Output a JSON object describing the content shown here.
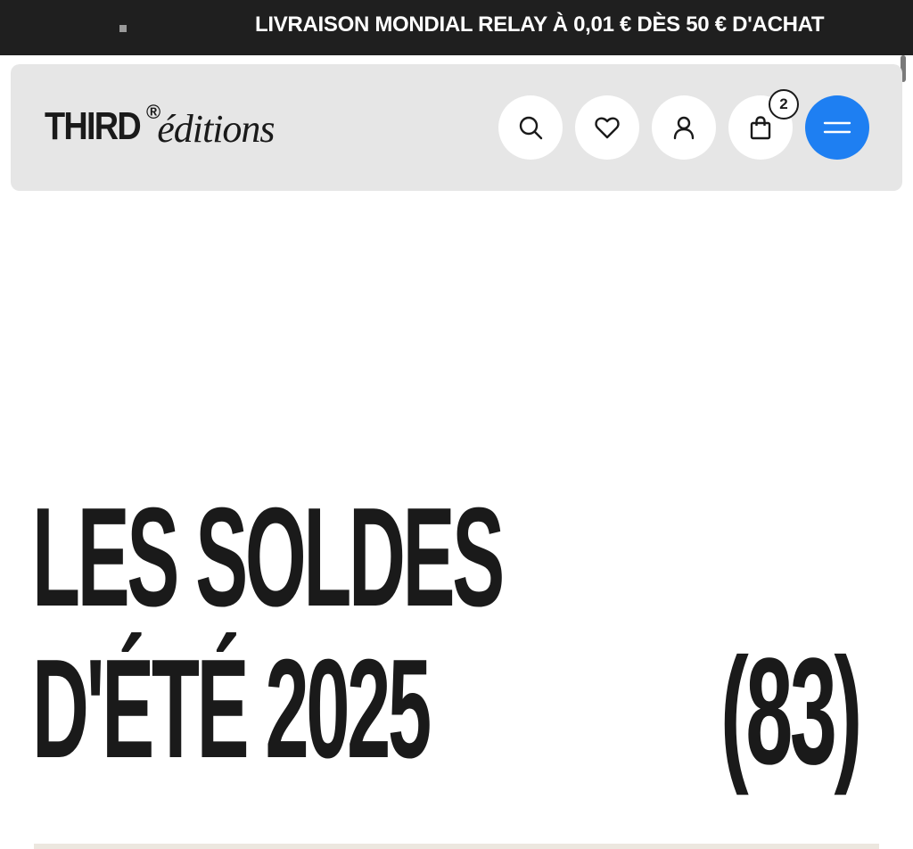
{
  "announcement": {
    "message": "LIVRAISON MONDIAL RELAY À 0,01 € DÈS 50 € D'ACHAT"
  },
  "header": {
    "logo": {
      "brand": "THIRD",
      "registered": "®",
      "editions": "éditions"
    },
    "icons": {
      "search": "search-icon",
      "wishlist": "heart-icon",
      "account": "user-icon",
      "cart": "shopping-bag-icon",
      "menu": "hamburger-menu-icon"
    },
    "cart_count": "2"
  },
  "hero": {
    "title_line1": "LES SOLDES",
    "title_line2": "D'ÉTÉ 2025",
    "count": "(83)"
  },
  "colors": {
    "announcement_bg": "#1f1f1f",
    "header_bg": "#e6e6e6",
    "menu_button": "#1e7ff2",
    "text": "#1a1a1a"
  }
}
